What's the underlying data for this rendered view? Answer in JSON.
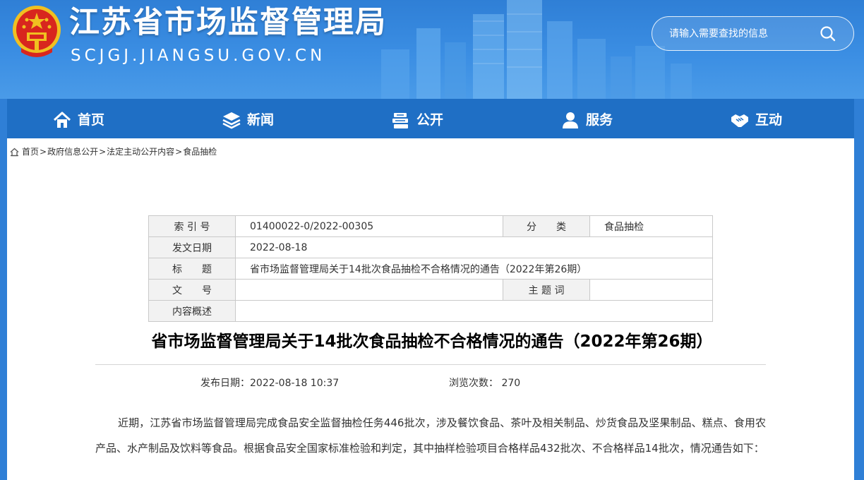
{
  "header": {
    "title": "江苏省市场监督管理局",
    "domain": "SCJGJ.JIANGSU.GOV.CN",
    "search_placeholder": "请输入需要查找的信息",
    "colors": {
      "header_blue": "#3b8ee3",
      "nav_blue": "#1f6fc5"
    }
  },
  "nav": [
    {
      "label": "首页",
      "icon": "home-icon"
    },
    {
      "label": "新闻",
      "icon": "layers-icon"
    },
    {
      "label": "公开",
      "icon": "stack-icon"
    },
    {
      "label": "服务",
      "icon": "user-icon"
    },
    {
      "label": "互动",
      "icon": "handshake-icon"
    }
  ],
  "breadcrumb": {
    "icon": "home-outline-icon",
    "items": [
      "首页",
      "政府信息公开",
      "法定主动公开内容",
      "食品抽检"
    ],
    "separator": ">"
  },
  "meta": {
    "index_label": "索 引 号",
    "index_value": "01400022-0/2022-00305",
    "category_label": "分　　类",
    "category_value": "食品抽检",
    "date_label": "发文日期",
    "date_value": "2022-08-18",
    "title_label": "标　　题",
    "title_value": "省市场监督管理局关于14批次食品抽检不合格情况的通告（2022年第26期）",
    "doc_no_label": "文　　号",
    "doc_no_value": "",
    "keywords_label": "主 题 词",
    "keywords_value": "",
    "summary_label": "内容概述",
    "summary_value": ""
  },
  "article": {
    "title": "省市场监督管理局关于14批次食品抽检不合格情况的通告（2022年第26期）",
    "publish_label": "发布日期：",
    "publish_value": "2022-08-18 10:37",
    "views_label": "浏览次数：",
    "views_value": "270",
    "paragraph": "近期，江苏省市场监督管理局完成食品安全监督抽检任务446批次，涉及餐饮食品、茶叶及相关制品、炒货食品及坚果制品、糕点、食用农产品、水产制品及饮料等食品。根据食品安全国家标准检验和判定，其中抽样检验项目合格样品432批次、不合格样品14批次，情况通告如下："
  }
}
